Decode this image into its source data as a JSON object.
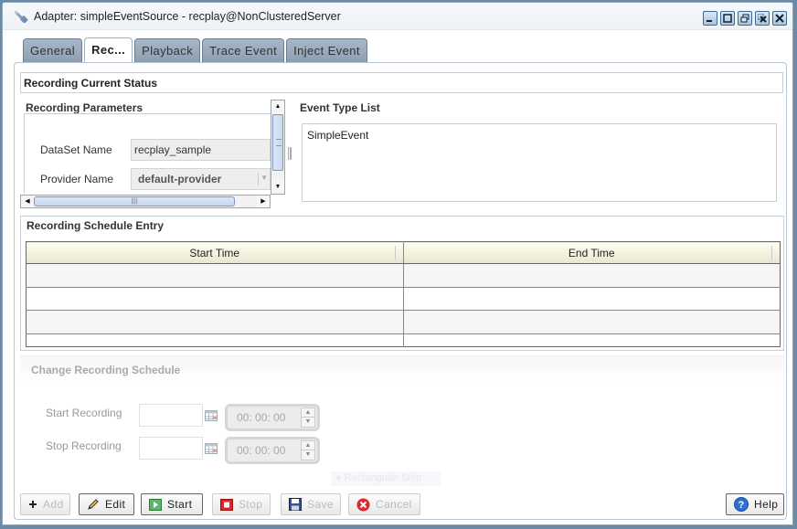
{
  "window": {
    "title": "Adapter: simpleEventSource - recplay@NonClusteredServer",
    "controls": [
      "minimize",
      "maximize",
      "restore",
      "close-all",
      "close"
    ]
  },
  "tabs": [
    {
      "label": "General",
      "active": false
    },
    {
      "label": "Rec...",
      "active": true
    },
    {
      "label": "Playback",
      "active": false
    },
    {
      "label": "Trace Event",
      "active": false
    },
    {
      "label": "Inject Event",
      "active": false
    }
  ],
  "status": {
    "title": "Recording Current Status"
  },
  "parameters": {
    "title": "Recording Parameters",
    "dataset_label": "DataSet Name",
    "dataset_value": "recplay_sample",
    "provider_label": "Provider Name",
    "provider_value": "default-provider"
  },
  "event_types": {
    "title": "Event Type List",
    "items": [
      "SimpleEvent"
    ]
  },
  "schedule": {
    "title": "Recording Schedule Entry",
    "columns": [
      "Start Time",
      "End Time"
    ],
    "rows": [
      [
        "",
        ""
      ],
      [
        "",
        ""
      ],
      [
        "",
        ""
      ],
      [
        "",
        ""
      ]
    ]
  },
  "change_schedule": {
    "title": "Change Recording Schedule",
    "start_label": "Start Recording",
    "start_date": "",
    "start_time": "00: 00: 00",
    "stop_label": "Stop Recording",
    "stop_date": "",
    "stop_time": "00: 00: 00"
  },
  "overlay": {
    "snip_label": "Rectangular Snip"
  },
  "buttons": {
    "add": {
      "label": "Add",
      "enabled": false
    },
    "edit": {
      "label": "Edit",
      "enabled": true
    },
    "start": {
      "label": "Start",
      "enabled": true
    },
    "stop": {
      "label": "Stop",
      "enabled": false
    },
    "save": {
      "label": "Save",
      "enabled": false
    },
    "cancel": {
      "label": "Cancel",
      "enabled": false
    },
    "help": {
      "label": "Help",
      "enabled": true
    }
  },
  "colors": {
    "tab_inactive": "#98a9bb",
    "grid_header": "#f2f1dc",
    "start_icon": "#3aa34a",
    "stop_icon": "#d9262c",
    "cancel_icon": "#e0282c",
    "help_icon": "#2f6fd0"
  }
}
